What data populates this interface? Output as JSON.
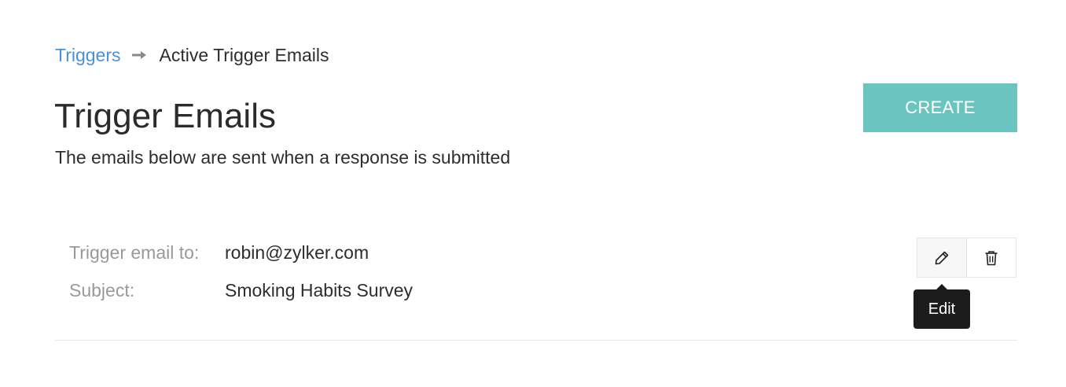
{
  "breadcrumb": {
    "parent": "Triggers",
    "current": "Active Trigger Emails",
    "separator_icon": "arrow-right-icon"
  },
  "header": {
    "title": "Trigger Emails",
    "subtitle": "The emails below are sent when a response is submitted",
    "create_label": "CREATE"
  },
  "trigger": {
    "email_label": "Trigger email to:",
    "email_value": "robin@zylker.com",
    "subject_label": "Subject:",
    "subject_value": "Smoking Habits Survey",
    "edit_icon": "pencil-icon",
    "delete_icon": "trash-icon",
    "tooltip": "Edit"
  },
  "colors": {
    "link": "#4a90d9",
    "accent": "#6cc4c1",
    "tooltip_bg": "#1c1c1c",
    "label_gray": "#999999"
  }
}
